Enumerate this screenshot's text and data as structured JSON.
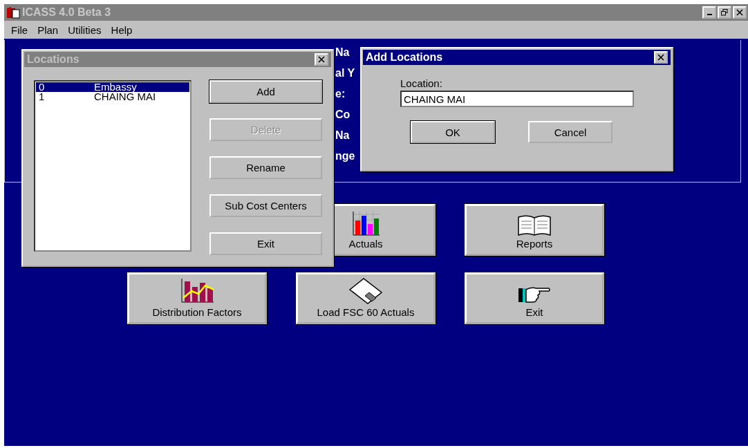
{
  "window": {
    "title": "ICASS 4.0 Beta 3"
  },
  "menu": [
    {
      "label": "File"
    },
    {
      "label": "Plan"
    },
    {
      "label": "Utilities"
    },
    {
      "label": "Help"
    }
  ],
  "background_labels": [
    "Na",
    "al Y",
    "e:",
    "Co",
    "Na",
    "nge"
  ],
  "main_buttons": [
    {
      "label": "Actuals",
      "kind": "bars"
    },
    {
      "label": "Reports",
      "kind": "book"
    },
    {
      "label": "Distribution Factors",
      "kind": "trend"
    },
    {
      "label": "Load FSC 60 Actuals",
      "kind": "disk"
    },
    {
      "label": "Exit",
      "kind": "hand"
    }
  ],
  "locations_dialog": {
    "title": "Locations",
    "active": false,
    "list": [
      {
        "code": "0",
        "name": "Embassy",
        "selected": true
      },
      {
        "code": "1",
        "name": "CHAING MAI",
        "selected": false
      }
    ],
    "buttons": [
      {
        "label": "Add",
        "default": true,
        "disabled": false
      },
      {
        "label": "Delete",
        "default": false,
        "disabled": true
      },
      {
        "label": "Rename",
        "default": false,
        "disabled": false
      },
      {
        "label": "Sub Cost Centers",
        "default": false,
        "disabled": false
      },
      {
        "label": "Exit",
        "default": false,
        "disabled": false
      }
    ]
  },
  "add_dialog": {
    "title": "Add Locations",
    "active": true,
    "field_label": "Location:",
    "value": "CHAING MAI",
    "buttons": [
      {
        "label": "OK",
        "default": true
      },
      {
        "label": "Cancel",
        "default": false
      }
    ]
  }
}
